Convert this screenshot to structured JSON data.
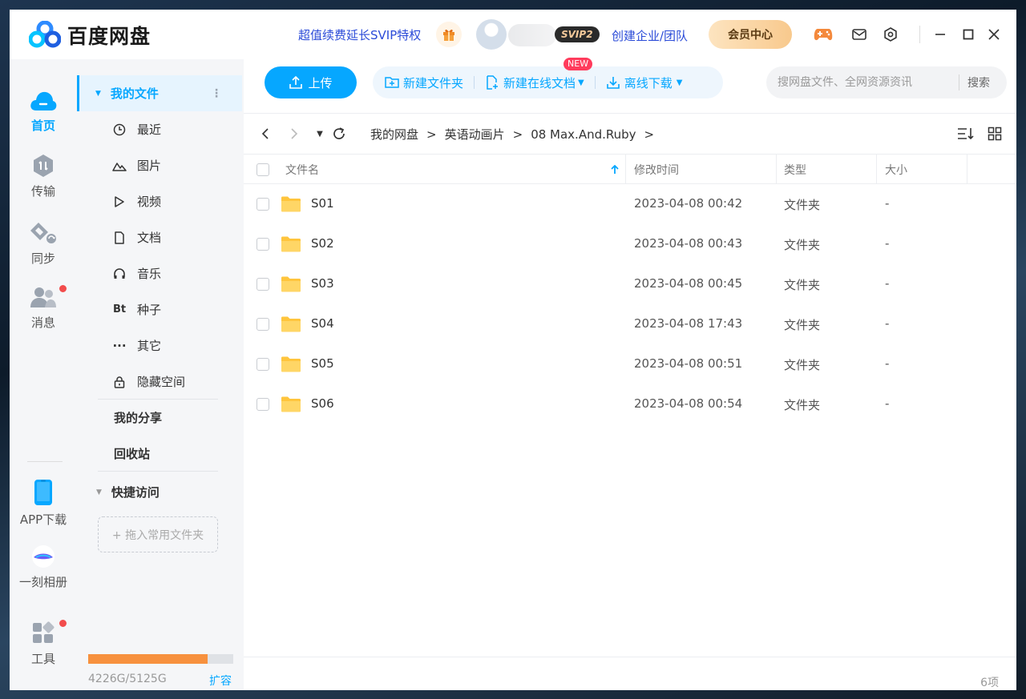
{
  "app": {
    "title": "百度网盘"
  },
  "header": {
    "promo": "超值续费延长SVIP特权",
    "svip_badge": "SVIP2",
    "team_link": "创建企业/团队",
    "member_center": "会员中心"
  },
  "rail": {
    "home": "首页",
    "transfer": "传输",
    "sync": "同步",
    "messages": "消息",
    "app_download": "APP下载",
    "album": "一刻相册",
    "tools": "工具"
  },
  "sidebar": {
    "my_files": "我的文件",
    "categories": [
      "最近",
      "图片",
      "视频",
      "文档",
      "音乐",
      "种子",
      "其它",
      "隐藏空间"
    ],
    "torrent_icon_text": "Bt",
    "my_share": "我的分享",
    "recycle_bin": "回收站",
    "quick_access": "快捷访问",
    "drop_hint": "+ 拖入常用文件夹",
    "quota_text": "4226G/5125G",
    "quota_used_fraction": 0.825,
    "expand": "扩容"
  },
  "toolbar": {
    "upload": "上传",
    "new_folder": "新建文件夹",
    "new_online_doc": "新建在线文档",
    "new_badge": "NEW",
    "offline_download": "离线下载",
    "search_placeholder": "搜网盘文件、全网资源资讯",
    "search_button": "搜索"
  },
  "breadcrumb": [
    "我的网盘",
    "英语动画片",
    "08 Max.And.Ruby"
  ],
  "breadcrumb_sep": ">",
  "table": {
    "columns": {
      "name": "文件名",
      "modified": "修改时间",
      "type": "类型",
      "size": "大小"
    },
    "rows": [
      {
        "name": "S01",
        "modified": "2023-04-08 00:42",
        "type": "文件夹",
        "size": "-"
      },
      {
        "name": "S02",
        "modified": "2023-04-08 00:43",
        "type": "文件夹",
        "size": "-"
      },
      {
        "name": "S03",
        "modified": "2023-04-08 00:45",
        "type": "文件夹",
        "size": "-"
      },
      {
        "name": "S04",
        "modified": "2023-04-08 17:43",
        "type": "文件夹",
        "size": "-"
      },
      {
        "name": "S05",
        "modified": "2023-04-08 00:51",
        "type": "文件夹",
        "size": "-"
      },
      {
        "name": "S06",
        "modified": "2023-04-08 00:54",
        "type": "文件夹",
        "size": "-"
      }
    ]
  },
  "footer": {
    "count": "6项"
  },
  "colors": {
    "accent": "#06a7ff",
    "quota": "#f7913e",
    "folder": "#ffc53d",
    "notify_dot": "#f24c4c"
  }
}
